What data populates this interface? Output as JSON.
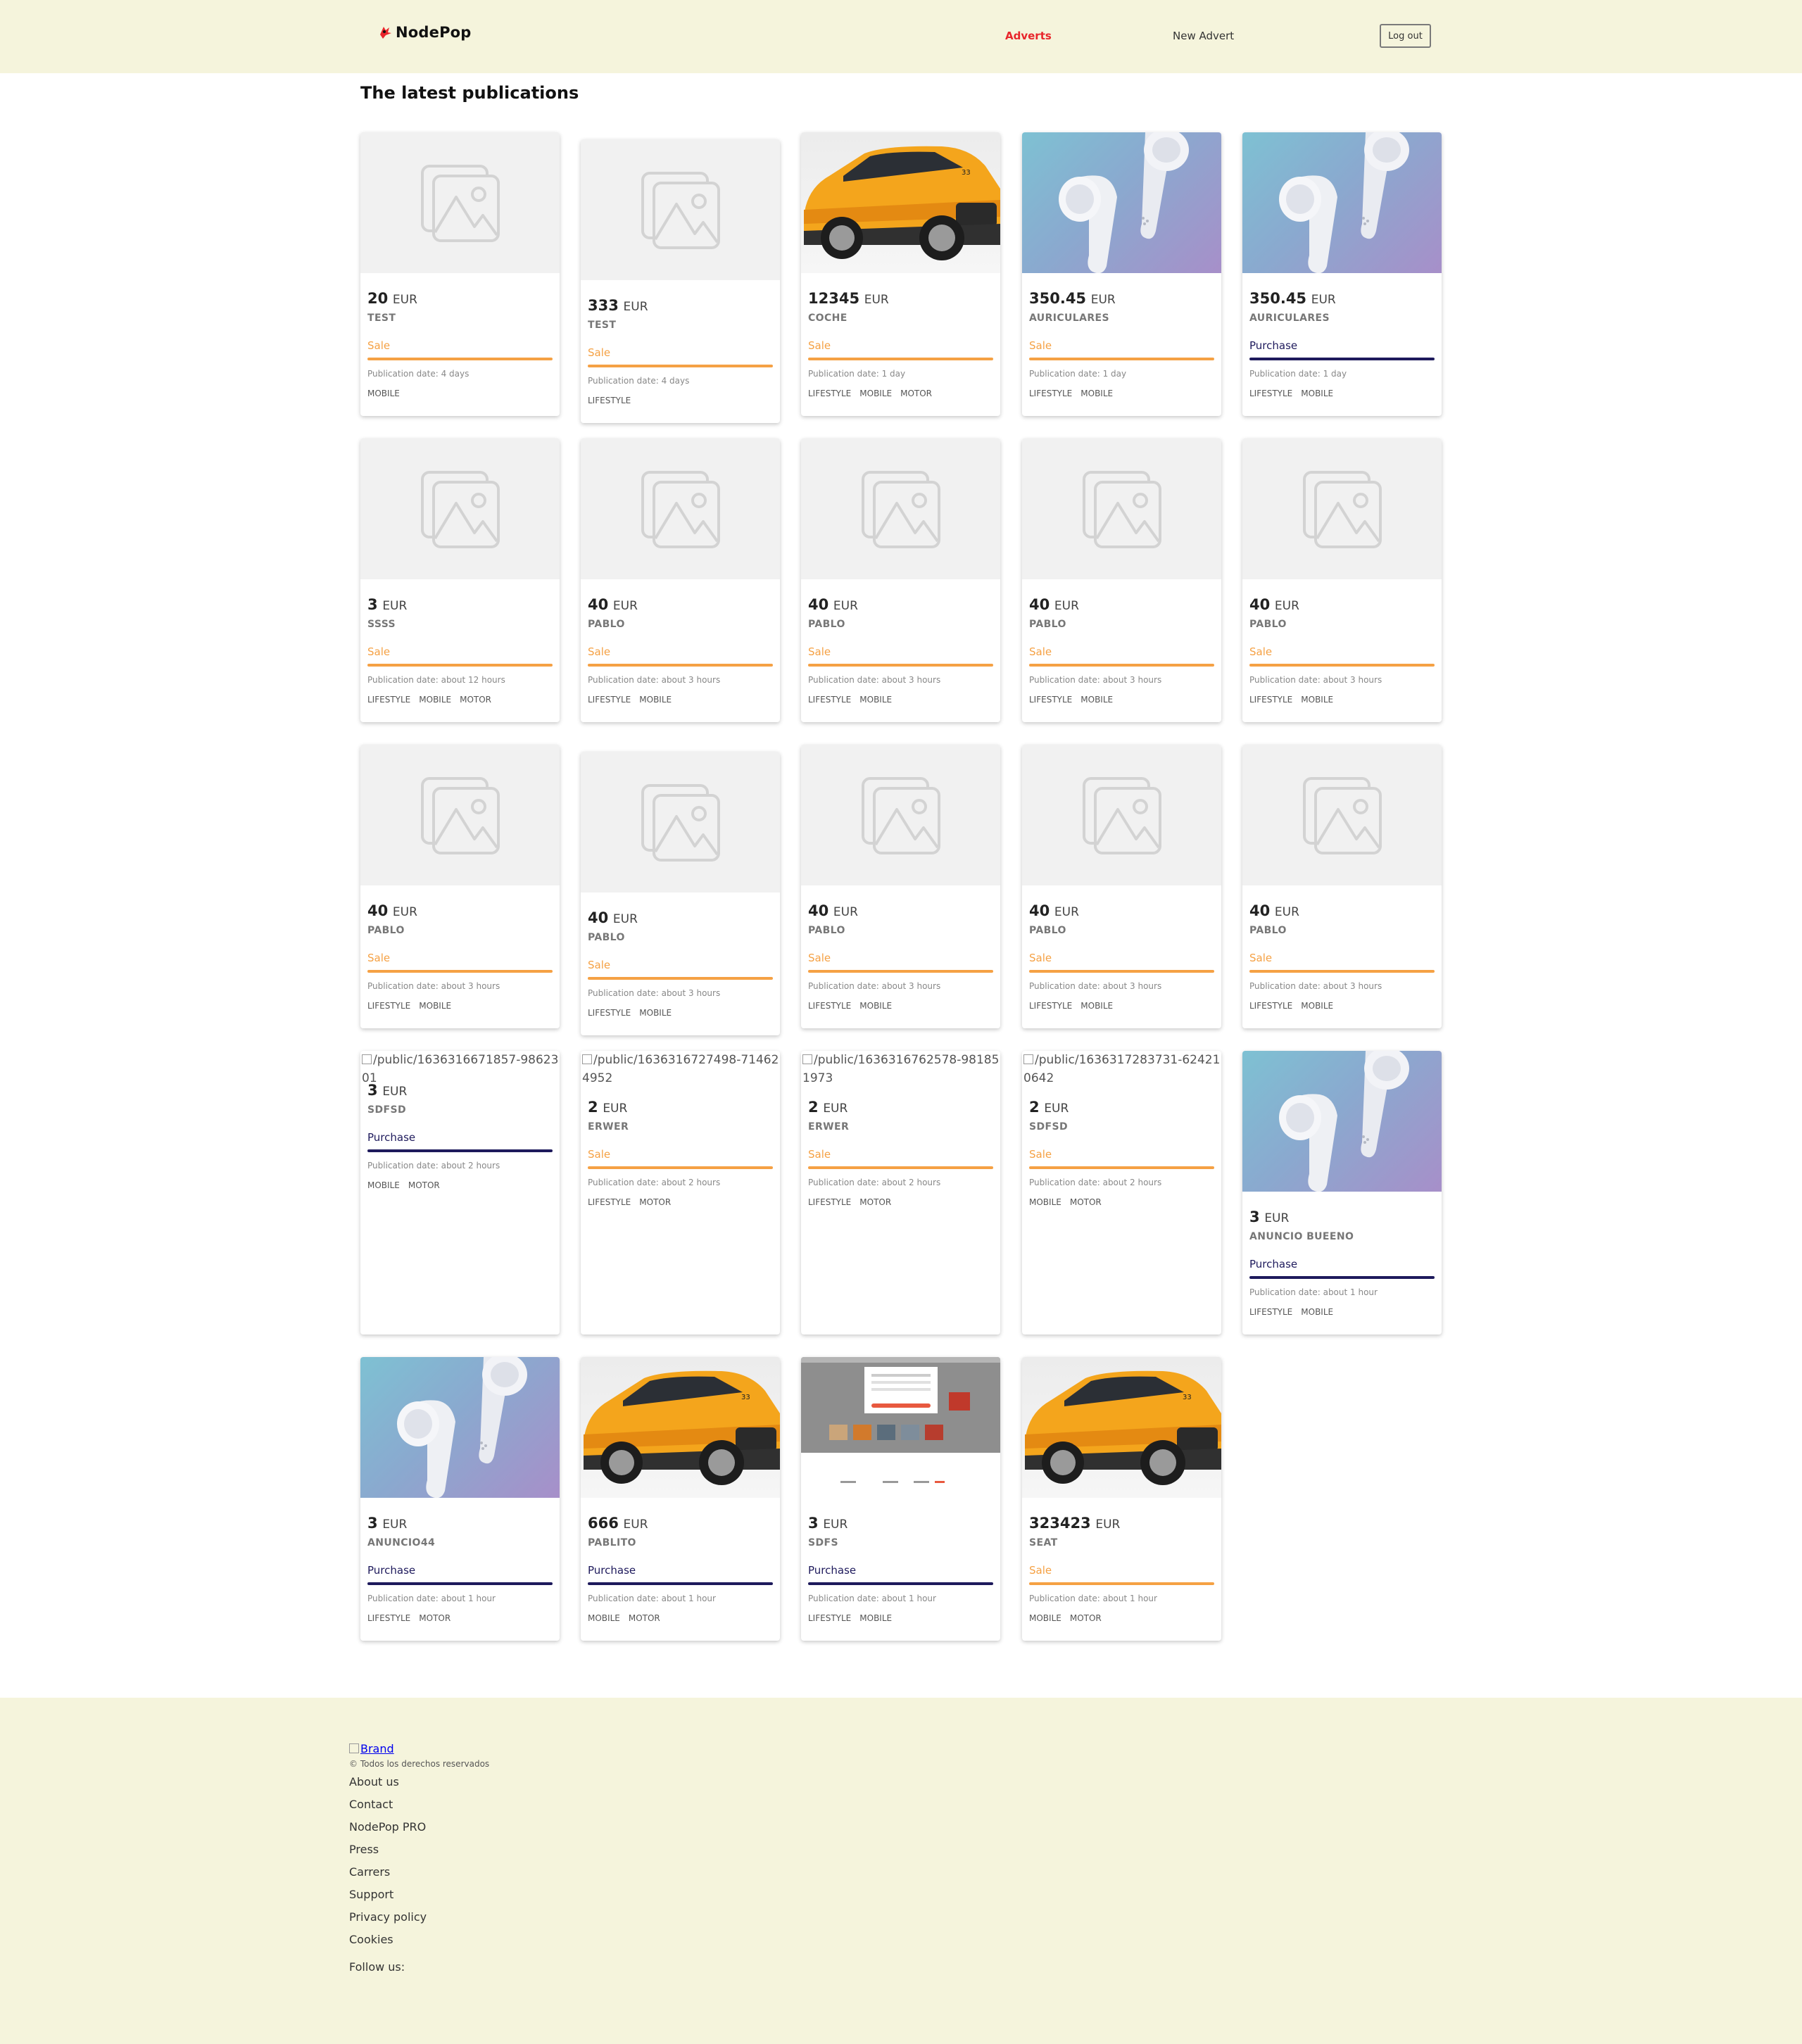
{
  "header": {
    "brand": "NodePop",
    "nav": {
      "adverts": "Adverts",
      "new_advert": "New Advert"
    },
    "logout": "Log out",
    "accent_color": "#e8262c",
    "background": "#f5f4dc"
  },
  "main": {
    "title": "The latest publications"
  },
  "ads": [
    {
      "image": "placeholder",
      "price": "20",
      "currency": "EUR",
      "name": "TEST",
      "type": "Sale",
      "date": "Publication date: 4 days",
      "tags": [
        "MOBILE"
      ]
    },
    {
      "image": "placeholder",
      "price": "333",
      "currency": "EUR",
      "name": "TEST",
      "type": "Sale",
      "date": "Publication date: 4 days",
      "tags": [
        "LIFESTYLE"
      ]
    },
    {
      "image": "car",
      "price": "12345",
      "currency": "EUR",
      "name": "COCHE",
      "type": "Sale",
      "date": "Publication date: 1 day",
      "tags": [
        "LIFESTYLE",
        "MOBILE",
        "MOTOR"
      ]
    },
    {
      "image": "earbuds",
      "price": "350.45",
      "currency": "EUR",
      "name": "AURICULARES",
      "type": "Sale",
      "date": "Publication date: 1 day",
      "tags": [
        "LIFESTYLE",
        "MOBILE"
      ]
    },
    {
      "image": "earbuds",
      "price": "350.45",
      "currency": "EUR",
      "name": "AURICULARES",
      "type": "Purchase",
      "date": "Publication date: 1 day",
      "tags": [
        "LIFESTYLE",
        "MOBILE"
      ]
    },
    {
      "image": "placeholder",
      "price": "3",
      "currency": "EUR",
      "name": "SSSS",
      "type": "Sale",
      "date": "Publication date: about 12 hours",
      "tags": [
        "LIFESTYLE",
        "MOBILE",
        "MOTOR"
      ]
    },
    {
      "image": "placeholder",
      "price": "40",
      "currency": "EUR",
      "name": "PABLO",
      "type": "Sale",
      "date": "Publication date: about 3 hours",
      "tags": [
        "LIFESTYLE",
        "MOBILE"
      ]
    },
    {
      "image": "placeholder",
      "price": "40",
      "currency": "EUR",
      "name": "PABLO",
      "type": "Sale",
      "date": "Publication date: about 3 hours",
      "tags": [
        "LIFESTYLE",
        "MOBILE"
      ]
    },
    {
      "image": "placeholder",
      "price": "40",
      "currency": "EUR",
      "name": "PABLO",
      "type": "Sale",
      "date": "Publication date: about 3 hours",
      "tags": [
        "LIFESTYLE",
        "MOBILE"
      ]
    },
    {
      "image": "placeholder",
      "price": "40",
      "currency": "EUR",
      "name": "PABLO",
      "type": "Sale",
      "date": "Publication date: about 3 hours",
      "tags": [
        "LIFESTYLE",
        "MOBILE"
      ]
    },
    {
      "image": "placeholder",
      "price": "40",
      "currency": "EUR",
      "name": "PABLO",
      "type": "Sale",
      "date": "Publication date: about 3 hours",
      "tags": [
        "LIFESTYLE",
        "MOBILE"
      ]
    },
    {
      "image": "placeholder",
      "price": "40",
      "currency": "EUR",
      "name": "PABLO",
      "type": "Sale",
      "date": "Publication date: about 3 hours",
      "tags": [
        "LIFESTYLE",
        "MOBILE"
      ]
    },
    {
      "image": "placeholder",
      "price": "40",
      "currency": "EUR",
      "name": "PABLO",
      "type": "Sale",
      "date": "Publication date: about 3 hours",
      "tags": [
        "LIFESTYLE",
        "MOBILE"
      ]
    },
    {
      "image": "placeholder",
      "price": "40",
      "currency": "EUR",
      "name": "PABLO",
      "type": "Sale",
      "date": "Publication date: about 3 hours",
      "tags": [
        "LIFESTYLE",
        "MOBILE"
      ]
    },
    {
      "image": "placeholder",
      "price": "40",
      "currency": "EUR",
      "name": "PABLO",
      "type": "Sale",
      "date": "Publication date: about 3 hours",
      "tags": [
        "LIFESTYLE",
        "MOBILE"
      ]
    },
    {
      "image": "broken",
      "alt": "/public/1636316671857-9862301",
      "price": "3",
      "currency": "EUR",
      "name": "SDFSD",
      "type": "Purchase",
      "date": "Publication date: about 2 hours",
      "tags": [
        "MOBILE",
        "MOTOR"
      ]
    },
    {
      "image": "broken",
      "alt": "/public/1636316727498-714624952",
      "price": "2",
      "currency": "EUR",
      "name": "ERWER",
      "type": "Sale",
      "date": "Publication date: about 2 hours",
      "tags": [
        "LIFESTYLE",
        "MOTOR"
      ]
    },
    {
      "image": "broken",
      "alt": "/public/1636316762578-981851973",
      "price": "2",
      "currency": "EUR",
      "name": "ERWER",
      "type": "Sale",
      "date": "Publication date: about 2 hours",
      "tags": [
        "LIFESTYLE",
        "MOTOR"
      ]
    },
    {
      "image": "broken",
      "alt": "/public/1636317283731-624210642",
      "price": "2",
      "currency": "EUR",
      "name": "SDFSD",
      "type": "Sale",
      "date": "Publication date: about 2 hours",
      "tags": [
        "MOBILE",
        "MOTOR"
      ]
    },
    {
      "image": "earbuds",
      "price": "3",
      "currency": "EUR",
      "name": "ANUNCIO BUEENO",
      "type": "Purchase",
      "date": "Publication date: about 1 hour",
      "tags": [
        "LIFESTYLE",
        "MOBILE"
      ]
    },
    {
      "image": "earbuds",
      "price": "3",
      "currency": "EUR",
      "name": "ANUNCIO44",
      "type": "Purchase",
      "date": "Publication date: about 1 hour",
      "tags": [
        "LIFESTYLE",
        "MOTOR"
      ]
    },
    {
      "image": "car",
      "price": "666",
      "currency": "EUR",
      "name": "PABLITO",
      "type": "Purchase",
      "date": "Publication date: about 1 hour",
      "tags": [
        "MOBILE",
        "MOTOR"
      ]
    },
    {
      "image": "screenshot",
      "price": "3",
      "currency": "EUR",
      "name": "SDFS",
      "type": "Purchase",
      "date": "Publication date: about 1 hour",
      "tags": [
        "LIFESTYLE",
        "MOBILE"
      ]
    },
    {
      "image": "car",
      "price": "323423",
      "currency": "EUR",
      "name": "SEAT",
      "type": "Sale",
      "date": "Publication date: about 1 hour",
      "tags": [
        "MOBILE",
        "MOTOR"
      ]
    }
  ],
  "colors": {
    "sale": "#f5a144",
    "purchase": "#1e1a5c"
  },
  "footer": {
    "brand_alt": "Brand",
    "copyright": "© Todos los derechos reservados",
    "links": [
      "About us",
      "Contact",
      "NodePop PRO",
      "Press",
      "Carrers",
      "Support",
      "Privacy policy",
      "Cookies"
    ],
    "follow": "Follow us:"
  }
}
